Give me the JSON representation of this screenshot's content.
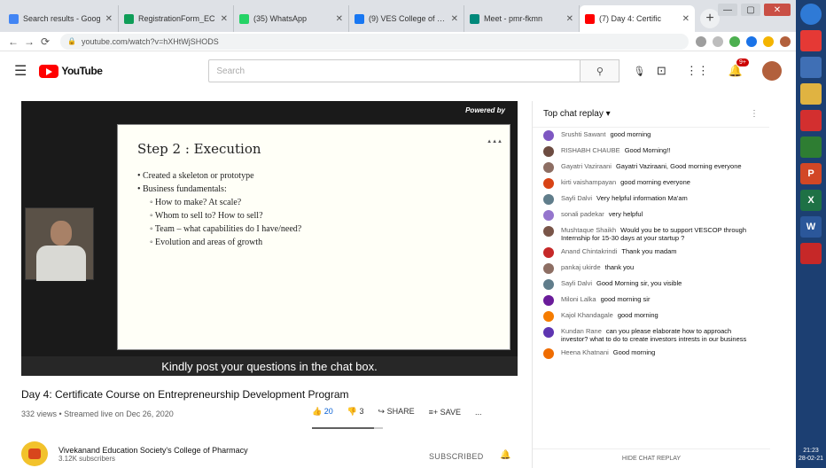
{
  "browser": {
    "tabs": [
      {
        "label": "Search results - Goog",
        "color": "#4285f4",
        "active": false
      },
      {
        "label": "RegistrationForm_EC",
        "color": "#0f9d58",
        "active": false
      },
      {
        "label": "(35) WhatsApp",
        "color": "#25d366",
        "active": false
      },
      {
        "label": "(9) VES College of Pha",
        "color": "#1877f2",
        "active": false
      },
      {
        "label": "Meet - pmr-fkmn",
        "color": "#00897b",
        "active": false
      },
      {
        "label": "(7) Day 4: Certific",
        "color": "#ff0000",
        "active": true
      }
    ],
    "url": "youtube.com/watch?v=hXHtWjSHODS"
  },
  "youtube": {
    "logo_text": "YouTube",
    "search_placeholder": "Search",
    "notification_count": "9+"
  },
  "video": {
    "slide_title": "Step 2 : Execution",
    "bullets": [
      {
        "text": "Created a skeleton or prototype",
        "sub": false
      },
      {
        "text": "Business fundamentals:",
        "sub": false
      },
      {
        "text": "How to make? At scale?",
        "sub": true
      },
      {
        "text": "Whom to sell to? How to sell?",
        "sub": true
      },
      {
        "text": "Team – what capabilities do I have/need?",
        "sub": true
      },
      {
        "text": "Evolution and areas of growth",
        "sub": true
      }
    ],
    "powered_by": "Powered by",
    "banner": "Kindly post your questions in the chat box."
  },
  "details": {
    "title": "Day 4: Certificate Course on Entrepreneurship Development Program",
    "meta": "332 views • Streamed live on Dec 26, 2020",
    "likes": "20",
    "dislikes": "3",
    "share": "SHARE",
    "save": "SAVE",
    "more": "...",
    "like_ratio": 0.87
  },
  "channel": {
    "name": "Vivekanand Education Society's College of Pharmacy",
    "subs": "3.12K subscribers",
    "subscribed_label": "SUBSCRIBED"
  },
  "chat": {
    "header": "Top chat replay",
    "hide_label": "HIDE CHAT REPLAY",
    "messages": [
      {
        "author": "Srushti Sawant",
        "text": "good morning",
        "color": "#7e57c2"
      },
      {
        "author": "RISHABH CHAUBE",
        "text": "Good Morning!!",
        "color": "#6d4c41"
      },
      {
        "author": "Gayatri Vaziraani",
        "text": "Gayatri Vaziraani, Good morning everyone",
        "color": "#8d6e63"
      },
      {
        "author": "kirti vaishampayan",
        "text": "good morning everyone",
        "color": "#d84315"
      },
      {
        "author": "Sayli Dalvi",
        "text": "Very helpful information Ma'am",
        "color": "#607d8b"
      },
      {
        "author": "sonali padekar",
        "text": "very helpful",
        "color": "#9575cd"
      },
      {
        "author": "Mushtaque Shaikh",
        "text": "Would you be to support VESCOP through Internship for 15-30 days at your startup ?",
        "color": "#795548"
      },
      {
        "author": "Anand Chintakrindi",
        "text": "Thank you madam",
        "color": "#c62828"
      },
      {
        "author": "pankaj ukirde",
        "text": "thank you",
        "color": "#8d6e63"
      },
      {
        "author": "Sayli Dalvi",
        "text": "Good Morning sir, you visible",
        "color": "#607d8b"
      },
      {
        "author": "Miloni Lalka",
        "text": "good morning sir",
        "color": "#6a1b9a"
      },
      {
        "author": "Kajol Khandagale",
        "text": "good morning",
        "color": "#f57c00"
      },
      {
        "author": "Kundan Rane",
        "text": "can you please elaborate how to approach investor? what to do to create investors intrests in our business",
        "color": "#5e35b1"
      },
      {
        "author": "Heena Khatnani",
        "text": "Good morning",
        "color": "#ef6c00"
      }
    ]
  },
  "taskbar": {
    "icons": [
      {
        "name": "chrome-icon",
        "label": "",
        "color": "#e53935"
      },
      {
        "name": "save-icon",
        "label": "",
        "color": "#3f6fb5"
      },
      {
        "name": "folder-icon",
        "label": "",
        "color": "#e0b341"
      },
      {
        "name": "pdf-icon",
        "label": "",
        "color": "#d32f2f"
      },
      {
        "name": "publisher-icon",
        "label": "",
        "color": "#2e7d32"
      },
      {
        "name": "powerpoint-icon",
        "label": "P",
        "color": "#d24726"
      },
      {
        "name": "excel-icon",
        "label": "X",
        "color": "#1e7145"
      },
      {
        "name": "word-icon",
        "label": "W",
        "color": "#2b579a"
      },
      {
        "name": "tool-icon",
        "label": "",
        "color": "#c62828"
      }
    ],
    "time": "21:23",
    "date": "28-02-21"
  }
}
